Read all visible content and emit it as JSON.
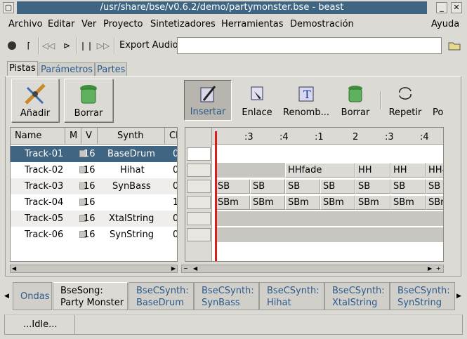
{
  "window": {
    "title": "/usr/share/bse/v0.6.2/demo/partymonster.bse - beast"
  },
  "menu": [
    "Archivo",
    "Editar",
    "Ver",
    "Proyecto",
    "Sintetizadores",
    "Herramientas",
    "Demostración",
    "Ayuda"
  ],
  "toolbar": {
    "export_label": "Export Audio",
    "export_value": ""
  },
  "tabs": [
    "Pistas",
    "Parámetros",
    "Partes"
  ],
  "track_buttons": [
    "Añadir",
    "Borrar"
  ],
  "part_tools": [
    "Insertar",
    "Enlace",
    "Renomb...",
    "Borrar",
    "Repetir",
    "Po"
  ],
  "track_columns": [
    "Name",
    "M",
    "V",
    "Synth",
    "Ch"
  ],
  "tracks": [
    {
      "name": "Track-01",
      "voices": "16",
      "synth": "BaseDrum",
      "ch": "0"
    },
    {
      "name": "Track-02",
      "voices": "16",
      "synth": "Hihat",
      "ch": "0"
    },
    {
      "name": "Track-03",
      "voices": "16",
      "synth": "SynBass",
      "ch": "0"
    },
    {
      "name": "Track-04",
      "voices": "16",
      "synth": "",
      "ch": "1"
    },
    {
      "name": "Track-05",
      "voices": "16",
      "synth": "XtalString",
      "ch": "0"
    },
    {
      "name": "Track-06",
      "voices": "16",
      "synth": "SynString",
      "ch": "0"
    }
  ],
  "ruler": [
    ":3",
    ":4",
    ":1",
    "2",
    ":3",
    ":4"
  ],
  "lanes": {
    "track2": [
      "HHfade",
      "HH",
      "HH",
      "HH-"
    ],
    "track3": [
      "SB",
      "SB",
      "SB",
      "SB",
      "SB",
      "SB",
      "SB"
    ],
    "track4": [
      "SBm",
      "SBm",
      "SBm",
      "SBm",
      "SBm",
      "SBm",
      "SBr"
    ]
  },
  "bottom_tabs": [
    [
      "Ondas",
      ""
    ],
    [
      "BseSong:",
      "Party Monster"
    ],
    [
      "BseCSynth:",
      "BaseDrum"
    ],
    [
      "BseCSynth:",
      "SynBass"
    ],
    [
      "BseCSynth:",
      "Hihat"
    ],
    [
      "BseCSynth:",
      "XtalString"
    ],
    [
      "BseCSynth:",
      "SynString"
    ]
  ],
  "status": {
    "text": "...Idle..."
  }
}
